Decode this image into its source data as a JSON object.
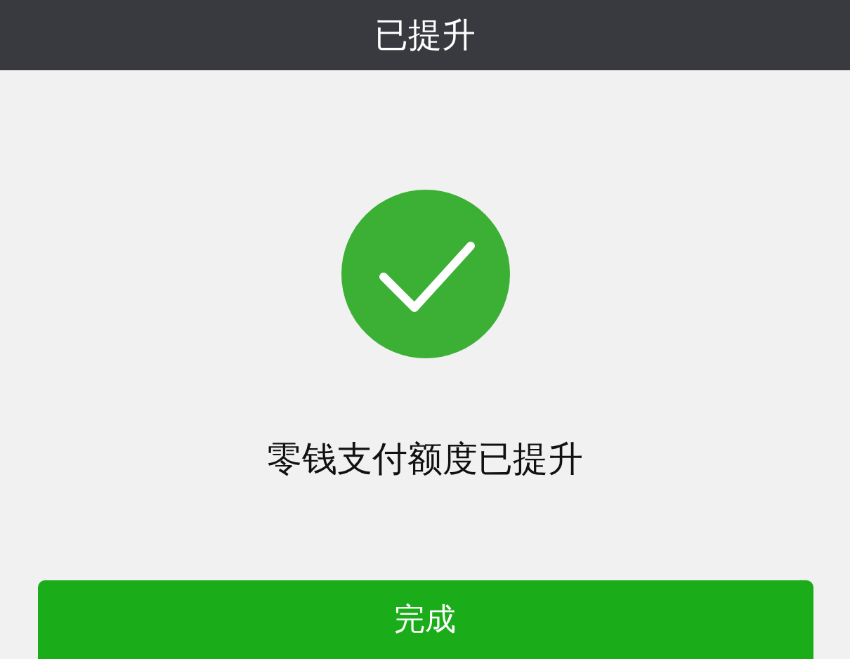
{
  "header": {
    "title": "已提升"
  },
  "message": "零钱支付额度已提升",
  "button": {
    "label": "完成"
  }
}
